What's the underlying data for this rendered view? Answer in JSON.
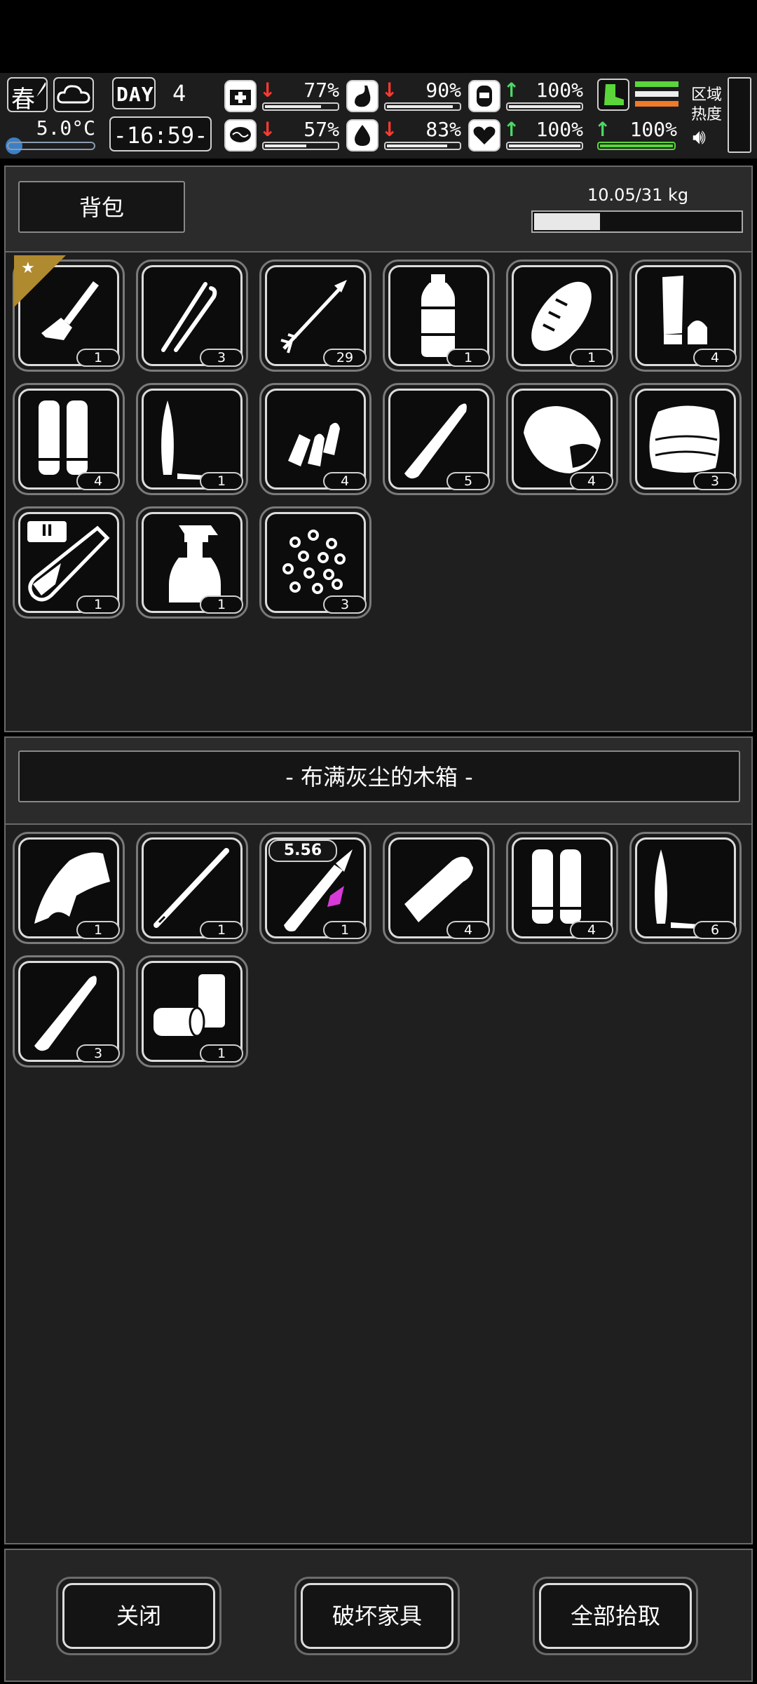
{
  "hud": {
    "season": "春",
    "temperature": "5.0°C",
    "day_label": "DAY",
    "day_number": "4",
    "clock": "-16:59-",
    "stats": [
      {
        "name": "health",
        "value": "77%",
        "trend": "down",
        "fill": 0.77
      },
      {
        "name": "hunger",
        "value": "90%",
        "trend": "down",
        "fill": 0.9
      },
      {
        "name": "energy",
        "value": "100%",
        "trend": "up",
        "fill": 1.0
      },
      {
        "name": "mood",
        "value": "57%",
        "trend": "down",
        "fill": 0.57
      },
      {
        "name": "thirst",
        "value": "83%",
        "trend": "down",
        "fill": 0.83
      },
      {
        "name": "heart",
        "value": "100%",
        "trend": "up",
        "fill": 1.0
      }
    ],
    "stamina": {
      "value": "100%",
      "trend": "up",
      "fill": 1.0
    },
    "region_label": "区域\n热度",
    "colors": {
      "down": "#ff3b30",
      "up": "#4cd964",
      "stamina_green": "#5bd63a",
      "stamina_orange": "#f07a2a"
    }
  },
  "backpack": {
    "title": "背包",
    "weight": "10.05/31 kg",
    "weight_fill": 0.3242,
    "items": [
      {
        "icon": "brush-icon",
        "count": "1",
        "favorite": true
      },
      {
        "icon": "tweezers-icon",
        "count": "3"
      },
      {
        "icon": "arrow-icon",
        "count": "29"
      },
      {
        "icon": "water-bottle-icon",
        "count": "1"
      },
      {
        "icon": "bread-icon",
        "count": "1"
      },
      {
        "icon": "lipstick-tube-icon",
        "count": "4"
      },
      {
        "icon": "shotgun-shells-icon",
        "count": "4"
      },
      {
        "icon": "bullet-tip-icon",
        "count": "1"
      },
      {
        "icon": "bullets-pile-icon",
        "count": "4"
      },
      {
        "icon": "bullet-icon",
        "count": "5"
      },
      {
        "icon": "meat-chunk-icon",
        "count": "4"
      },
      {
        "icon": "cloth-icon",
        "count": "3"
      },
      {
        "icon": "test-tube-icon",
        "count": "1",
        "badge": "II"
      },
      {
        "icon": "spray-bottle-icon",
        "count": "1"
      },
      {
        "icon": "pellets-icon",
        "count": "3"
      }
    ]
  },
  "container": {
    "title": "- 布满灰尘的木箱 -",
    "items": [
      {
        "icon": "claw-icon",
        "count": "1"
      },
      {
        "icon": "metal-rod-icon",
        "count": "1"
      },
      {
        "icon": "rifle-cartridge-icon",
        "count": "1",
        "caliber": "5.56"
      },
      {
        "icon": "bullet-casing-icon",
        "count": "4"
      },
      {
        "icon": "shotgun-shells-icon",
        "count": "4"
      },
      {
        "icon": "bullet-tip-icon",
        "count": "6"
      },
      {
        "icon": "bullet-icon",
        "count": "3"
      },
      {
        "icon": "cans-icon",
        "count": "1"
      }
    ]
  },
  "buttons": {
    "close": "关闭",
    "destroy": "破坏家具",
    "take_all": "全部拾取"
  }
}
